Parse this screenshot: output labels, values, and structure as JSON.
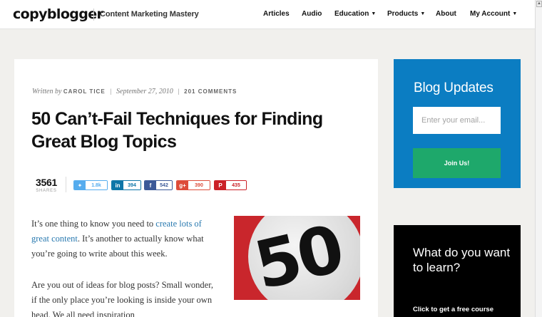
{
  "header": {
    "logo": "copyblogger",
    "tagline": "Content Marketing Mastery",
    "nav": [
      {
        "label": "Articles",
        "has_caret": false
      },
      {
        "label": "Audio",
        "has_caret": false
      },
      {
        "label": "Education",
        "has_caret": true
      },
      {
        "label": "Products",
        "has_caret": true
      },
      {
        "label": "About",
        "has_caret": false
      },
      {
        "label": "My Account",
        "has_caret": true
      }
    ]
  },
  "article": {
    "written_by": "Written by",
    "author": "CAROL TICE",
    "date": "September 27, 2010",
    "comments": "201 COMMENTS",
    "title": "50 Can’t-Fail Techniques for Finding Great Blog Topics",
    "shares": {
      "total": "3561",
      "label": "SHARES",
      "twitter": "1.8k",
      "linkedin": "394",
      "facebook": "542",
      "googleplus": "390",
      "pinterest": "435"
    },
    "p1_before": "It’s one thing to know you need to ",
    "p1_link": "create lots of great content",
    "p1_after": ". It’s another to actually know what you’re going to write about this week.",
    "p2": "Are you out of ideas for blog posts? Small wonder, if the only place you’re looking is inside your own head. We all need inspiration",
    "image_text": "50"
  },
  "sidebar": {
    "blog_updates_title": "Blog Updates",
    "email_placeholder": "Enter your email...",
    "join_label": "Join Us!",
    "learn_title": "What do you want to learn?",
    "learn_sub": "Click to get a free course"
  },
  "colors": {
    "brand_blue": "#0b7dc2",
    "join_green": "#1ea86b",
    "link_blue": "#2a7ab0",
    "sign_red": "#c9262c"
  }
}
